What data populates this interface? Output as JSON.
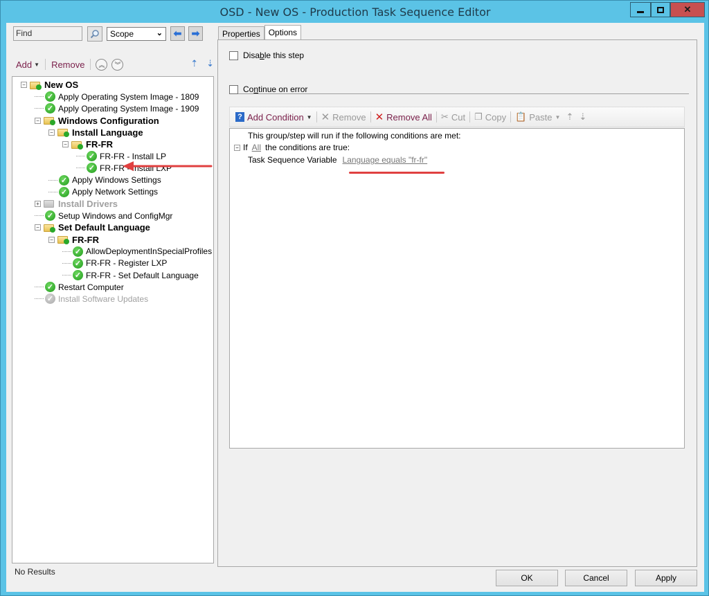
{
  "window": {
    "title": "OSD - New OS - Production Task Sequence Editor",
    "controls": {
      "minimize": "—",
      "maximize": "□",
      "close": "✕"
    }
  },
  "left_pane": {
    "find_placeholder": "Find",
    "scope_value": "Scope",
    "toolbar": {
      "add_label": "Add",
      "remove_label": "Remove"
    },
    "tree": [
      {
        "label": "New OS",
        "type": "group",
        "level": 0,
        "expander": "−",
        "icon": "folder-check"
      },
      {
        "label": "Apply Operating System Image - 1809",
        "type": "step",
        "level": 1,
        "icon": "check"
      },
      {
        "label": "Apply Operating System Image - 1909",
        "type": "step",
        "level": 1,
        "icon": "check"
      },
      {
        "label": "Windows Configuration",
        "type": "group",
        "level": 1,
        "expander": "−",
        "icon": "folder-check"
      },
      {
        "label": "Install Language",
        "type": "group",
        "level": 2,
        "expander": "−",
        "icon": "folder-check"
      },
      {
        "label": "FR-FR",
        "type": "group",
        "level": 3,
        "expander": "−",
        "icon": "folder-check",
        "selected": true
      },
      {
        "label": "FR-FR - Install LP",
        "type": "step",
        "level": 4,
        "icon": "check"
      },
      {
        "label": "FR-FR - Install LXP",
        "type": "step",
        "level": 4,
        "icon": "check"
      },
      {
        "label": "Apply Windows Settings",
        "type": "step",
        "level": 2,
        "icon": "check"
      },
      {
        "label": "Apply Network Settings",
        "type": "step",
        "level": 2,
        "icon": "check"
      },
      {
        "label": "Install Drivers",
        "type": "group",
        "level": 1,
        "expander": "+",
        "icon": "folder-disabled",
        "disabled": true
      },
      {
        "label": "Setup Windows and ConfigMgr",
        "type": "step",
        "level": 1,
        "icon": "check"
      },
      {
        "label": "Set Default Language",
        "type": "group",
        "level": 1,
        "expander": "−",
        "icon": "folder-check"
      },
      {
        "label": "FR-FR",
        "type": "group",
        "level": 2,
        "expander": "−",
        "icon": "folder-check"
      },
      {
        "label": "AllowDeploymentInSpecialProfiles",
        "type": "step",
        "level": 3,
        "icon": "check"
      },
      {
        "label": "FR-FR - Register LXP",
        "type": "step",
        "level": 3,
        "icon": "check"
      },
      {
        "label": "FR-FR - Set Default Language",
        "type": "step",
        "level": 3,
        "icon": "check"
      },
      {
        "label": "Restart Computer",
        "type": "step",
        "level": 1,
        "icon": "check"
      },
      {
        "label": "Install Software Updates",
        "type": "step",
        "level": 1,
        "icon": "check-disabled",
        "disabled": true
      }
    ],
    "status": "No Results"
  },
  "right_pane": {
    "tabs": [
      {
        "label": "Properties",
        "active": false
      },
      {
        "label": "Options",
        "active": true
      }
    ],
    "options": {
      "disable_step": {
        "pre": "Disa",
        "ul": "b",
        "post": "le this step",
        "checked": false
      },
      "continue_on_error": {
        "pre": "Co",
        "ul": "n",
        "post": "tinue on error",
        "checked": false
      }
    },
    "condition_toolbar": {
      "add_condition": "Add Condition",
      "remove": "Remove",
      "remove_all": "Remove All",
      "cut": "Cut",
      "copy": "Copy",
      "paste": "Paste"
    },
    "conditions": {
      "intro": "This group/step will run if the following conditions are met:",
      "if_label": "If",
      "all_link": "All",
      "if_suffix": "the conditions are true:",
      "item_type": "Task Sequence Variable",
      "item_link": "Language equals \"fr-fr\""
    }
  },
  "buttons": {
    "ok": "OK",
    "cancel": "Cancel",
    "apply": "Apply"
  },
  "colors": {
    "title_bar": "#5bc3e6",
    "close_button": "#c75050",
    "link_accent": "#7a1f4a",
    "annotation_red": "#e04040"
  }
}
